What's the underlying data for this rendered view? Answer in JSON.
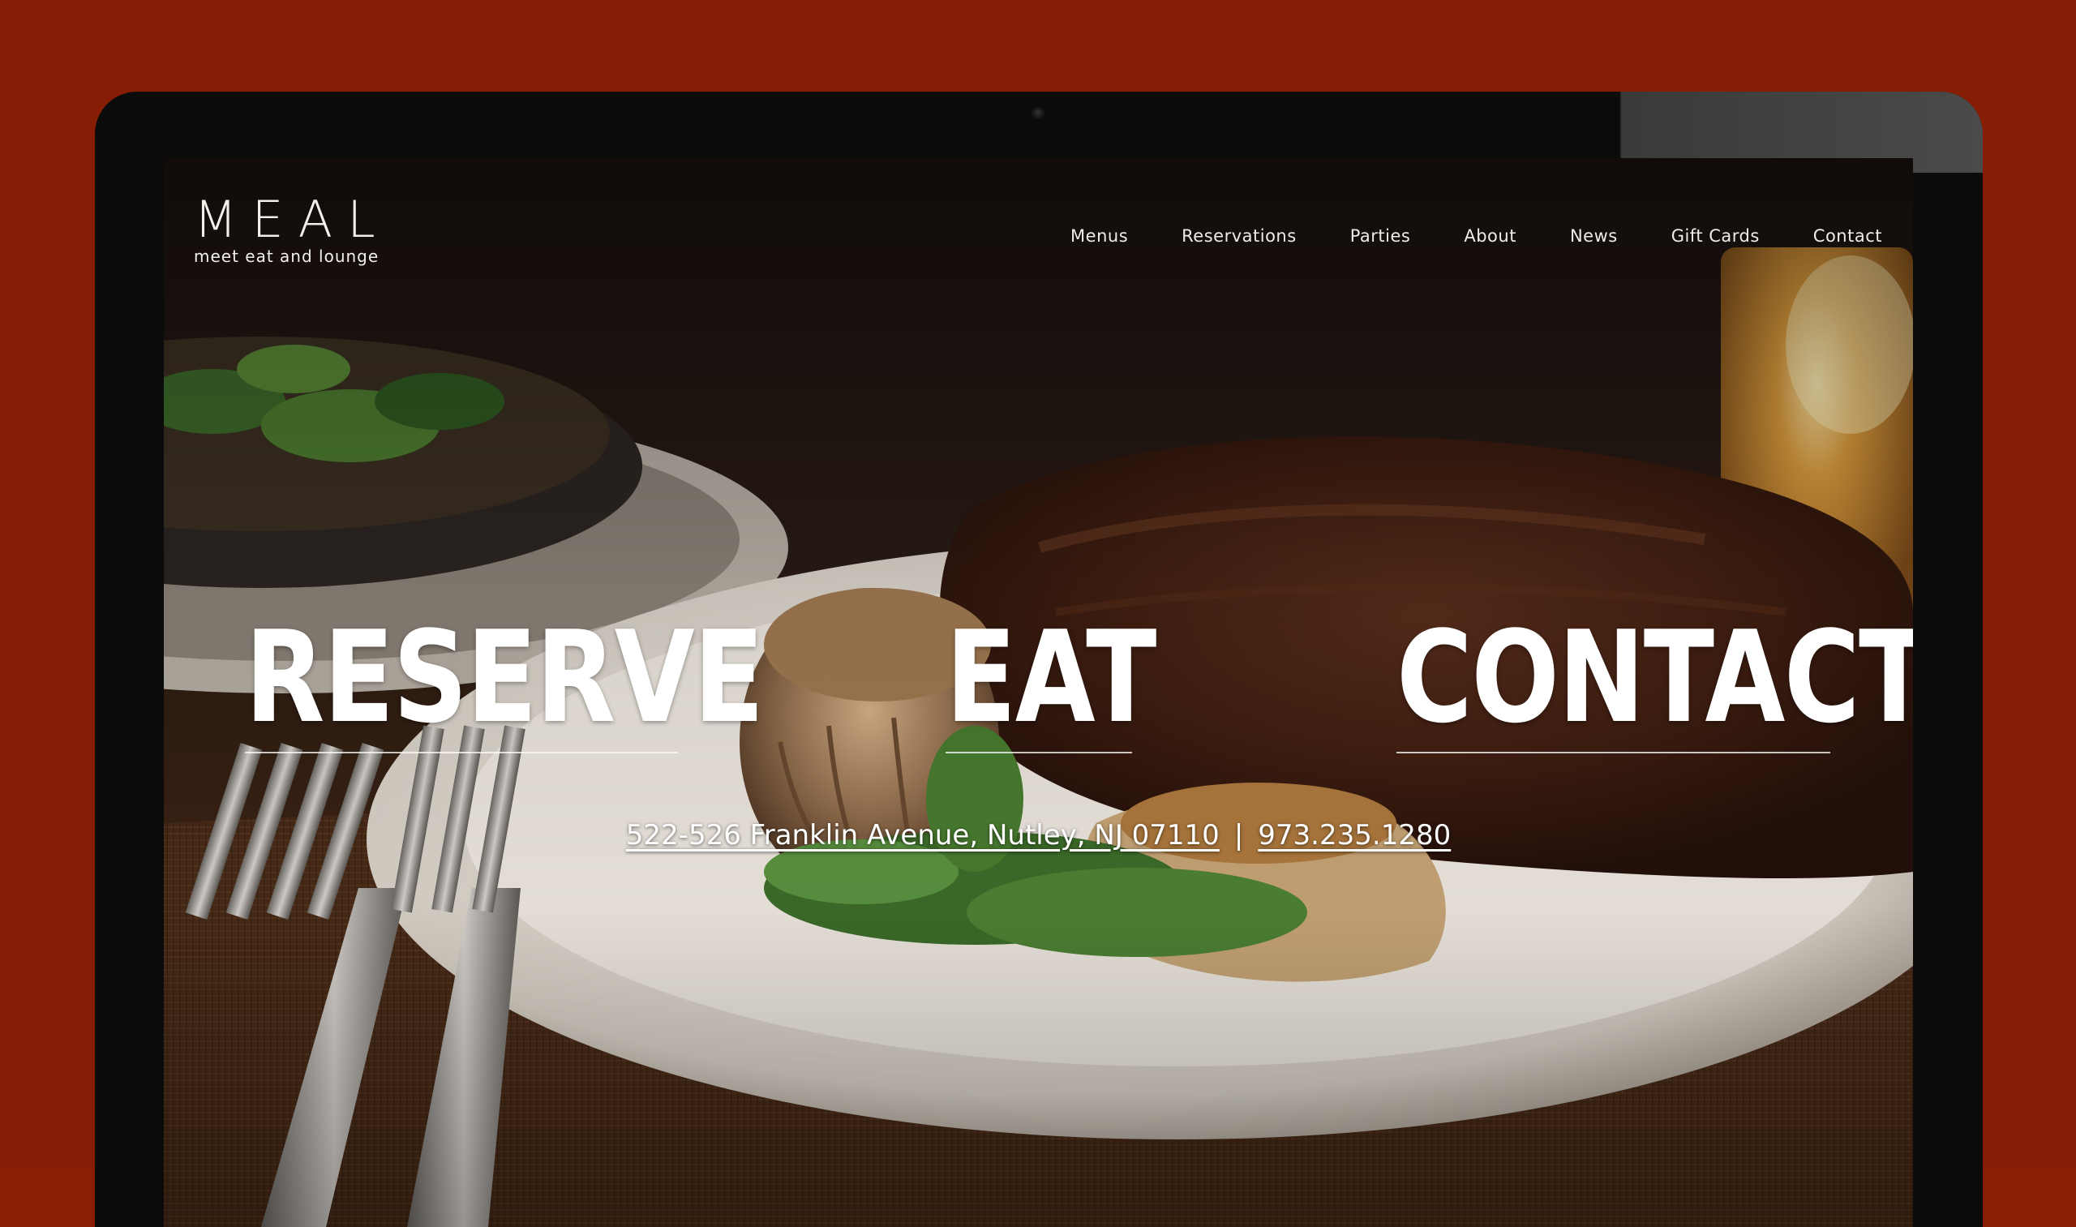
{
  "brand": {
    "name": "MEAL",
    "tagline": "meet eat and lounge"
  },
  "nav": {
    "items": [
      {
        "label": "Menus"
      },
      {
        "label": "Reservations"
      },
      {
        "label": "Parties"
      },
      {
        "label": "About"
      },
      {
        "label": "News"
      },
      {
        "label": "Gift Cards"
      },
      {
        "label": "Contact"
      }
    ]
  },
  "hero": {
    "reserve": "RESERVE",
    "eat": "EAT",
    "contact": "CONTACT"
  },
  "info": {
    "address": "522-526 Franklin Avenue, Nutley, NJ 07110",
    "separator": "|",
    "phone": "973.235.1280"
  },
  "colors": {
    "page_background": "#861d04",
    "text": "#ffffff"
  }
}
